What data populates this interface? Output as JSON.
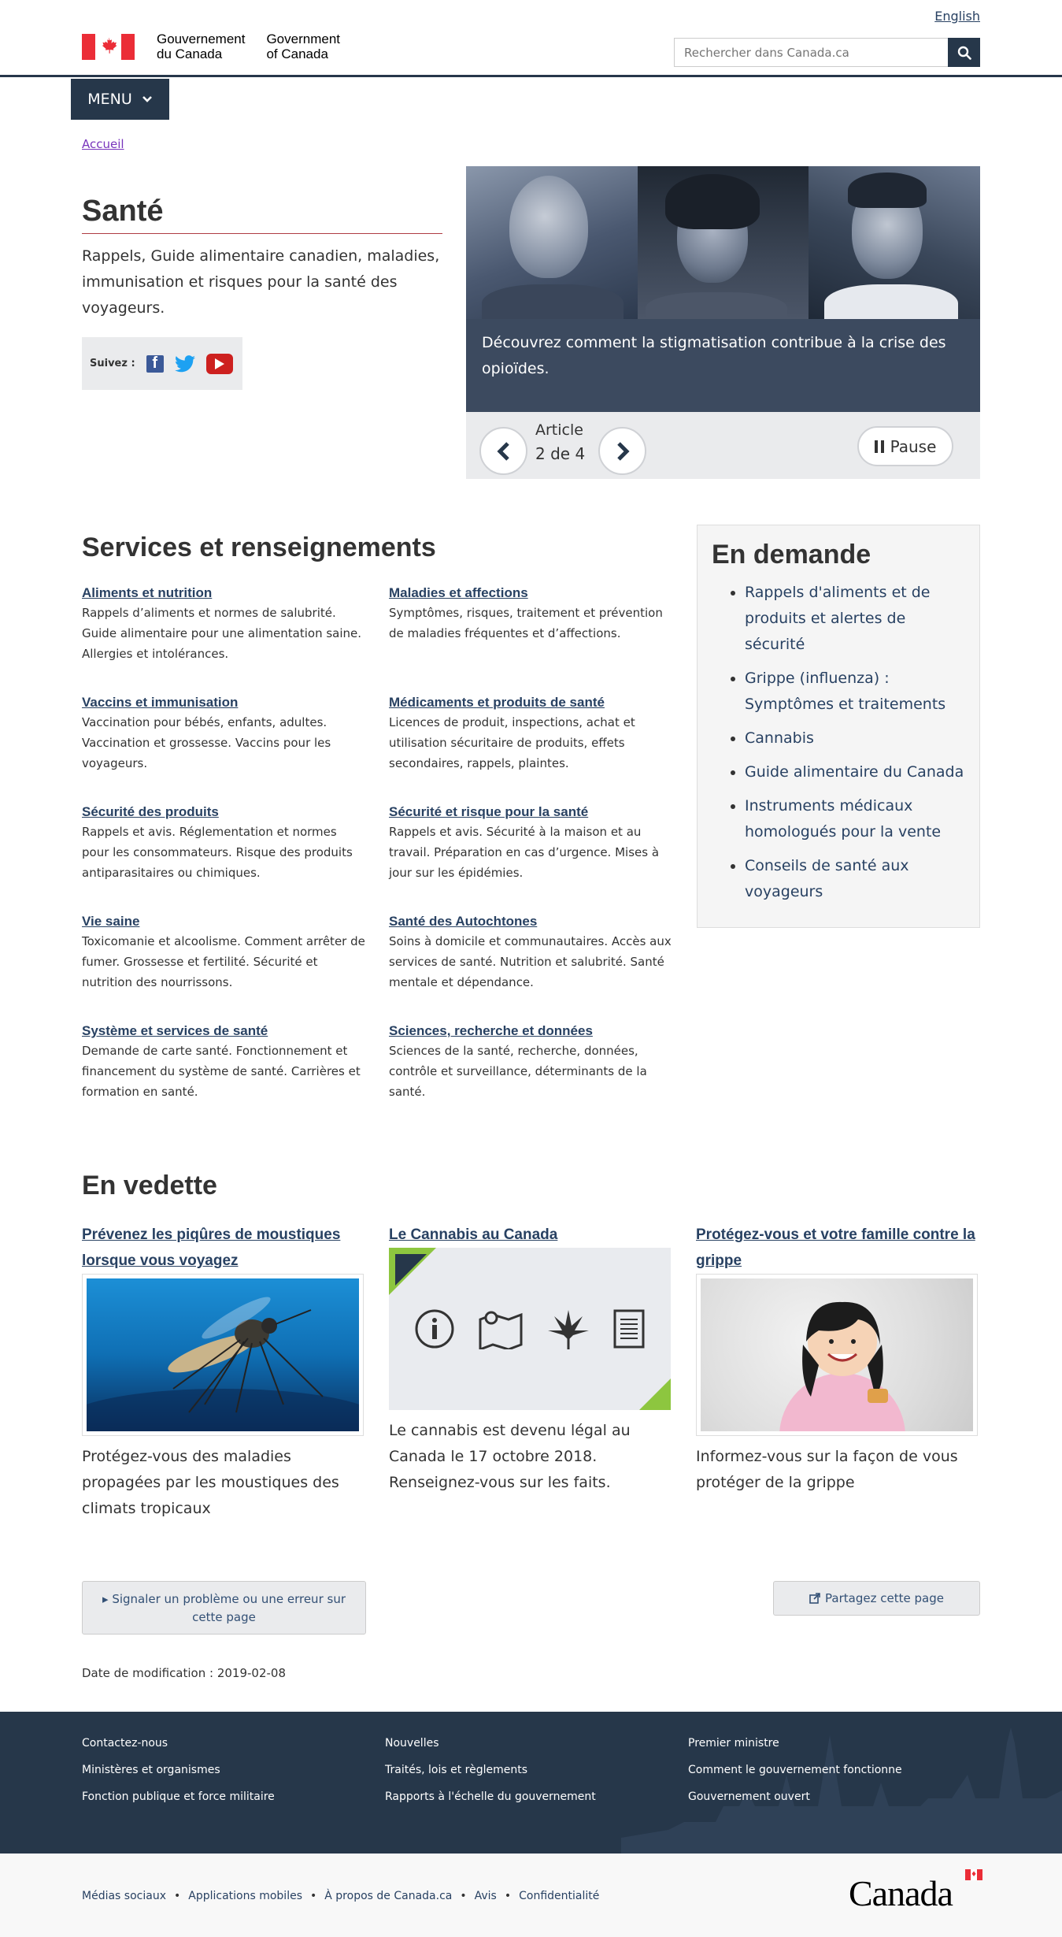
{
  "header": {
    "lang_link": "English",
    "wordmark_fr": [
      "Gouvernement",
      "du Canada"
    ],
    "wordmark_en": [
      "Government",
      "of Canada"
    ],
    "search_placeholder": "Rechercher dans Canada.ca",
    "menu_label": "MENU",
    "breadcrumb": "Accueil"
  },
  "hero": {
    "title": "Santé",
    "intro": "Rappels, Guide alimentaire canadien, maladies, immunisation et risques pour la santé des voyageurs.",
    "follow_label": "Suivez :"
  },
  "carousel": {
    "caption": "Découvrez comment la stigmatisation contribue à la crise des opioïdes.",
    "article_label": "Article",
    "article_count": "2 de 4",
    "pause_label": "Pause"
  },
  "services": {
    "title": "Services et renseignements",
    "items": [
      {
        "label": "Aliments et nutrition",
        "desc": "Rappels d’aliments et normes de salubrité. Guide alimentaire pour une alimentation saine. Allergies et intolérances."
      },
      {
        "label": "Maladies et affections",
        "desc": "Symptômes, risques, traitement et prévention de maladies fréquentes et d’affections."
      },
      {
        "label": "Vaccins et immunisation",
        "desc": "Vaccination pour bébés, enfants, adultes. Vaccination et grossesse. Vaccins pour les voyageurs."
      },
      {
        "label": "Médicaments et produits de santé",
        "desc": "Licences de produit, inspections, achat et utilisation sécuritaire de produits, effets secondaires, rappels, plaintes."
      },
      {
        "label": "Sécurité des produits",
        "desc": "Rappels et avis. Réglementation et normes pour les consommateurs. Risque des produits antiparasitaires ou chimiques."
      },
      {
        "label": "Sécurité et risque pour la santé",
        "desc": "Rappels et avis. Sécurité à la maison et au travail. Préparation en cas d’urgence. Mises à jour sur les épidémies."
      },
      {
        "label": "Vie saine",
        "desc": "Toxicomanie et alcoolisme. Comment arrêter de fumer. Grossesse et fertilité. Sécurité et nutrition des nourrissons."
      },
      {
        "label": "Santé des Autochtones",
        "desc": "Soins à domicile et communautaires. Accès aux services de santé. Nutrition et salubrité. Santé mentale et dépendance."
      },
      {
        "label": "Système et services de santé",
        "desc": "Demande de carte santé. Fonctionnement et financement du système de santé. Carrières et formation en santé."
      },
      {
        "label": "Sciences, recherche et données",
        "desc": "Sciences de la santé, recherche, données, contrôle et surveillance, déterminants de la santé."
      }
    ]
  },
  "demand": {
    "title": "En demande",
    "items": [
      "Rappels d'aliments et de produits et alertes de sécurité",
      "Grippe (influenza) : Symptômes et traitements",
      "Cannabis",
      "Guide alimentaire du Canada",
      "Instruments médicaux homologués pour la vente",
      "Conseils de santé aux voyageurs"
    ]
  },
  "featured": {
    "title": "En vedette",
    "items": [
      {
        "label": "Prévenez les piqûres de moustiques lorsque vous voyagez",
        "desc": "Protégez-vous des maladies propagées par les moustiques des climats tropicaux"
      },
      {
        "label": "Le Cannabis au Canada",
        "desc": "Le cannabis est devenu légal au Canada le 17 octobre 2018. Renseignez-vous sur les faits."
      },
      {
        "label": "Protégez-vous et votre famille contre la grippe",
        "desc": "Informez-vous sur la façon de vous protéger de la grippe"
      }
    ]
  },
  "actions": {
    "report": "Signaler un problème ou une erreur sur cette page",
    "share": "Partagez cette page",
    "date_modified": "Date de modification : 2019-02-08"
  },
  "footer": {
    "links": [
      "Contactez-nous",
      "Nouvelles",
      "Premier ministre",
      "Ministères et organismes",
      "Traités, lois et règlements",
      "Comment le gouvernement fonctionne",
      "Fonction publique et force militaire",
      "Rapports à l'échelle du gouvernement",
      "Gouvernement ouvert"
    ],
    "sub_links": [
      "Médias sociaux",
      "Applications mobiles",
      "À propos de Canada.ca",
      "Avis",
      "Confidentialité"
    ],
    "wordmark": "Canada"
  },
  "colors": {
    "navy": "#26374a",
    "link": "#284162",
    "visited": "#7834bc",
    "title_rule": "#af3c43",
    "flag_red": "#eb2d37"
  }
}
